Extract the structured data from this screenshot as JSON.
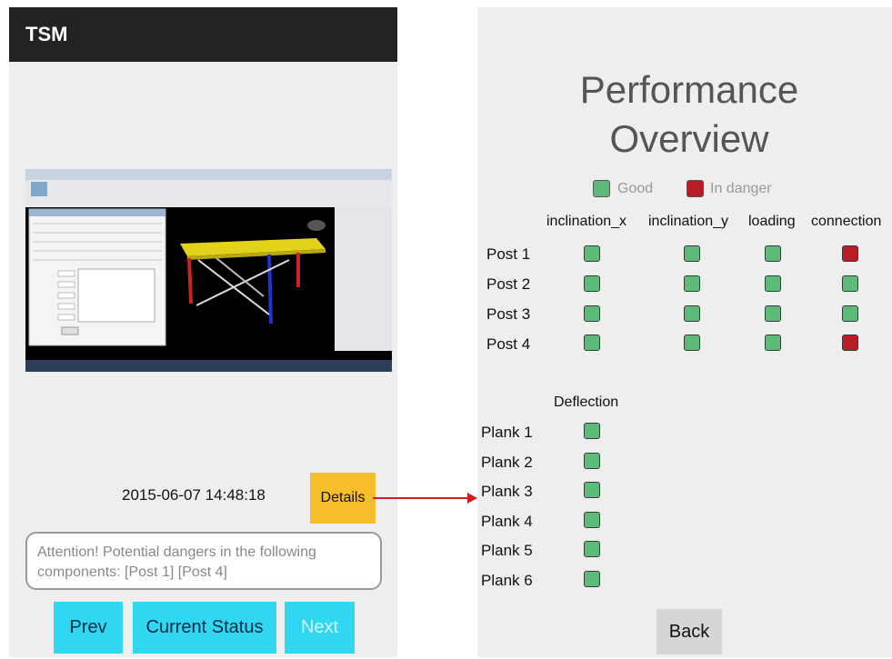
{
  "left_screen": {
    "app_title": "TSM",
    "timestamp": "2015-06-07 14:48:18",
    "details_label": "Details",
    "alert_text": "Attention! Potential dangers in the following components: [Post 1] [Post 4]",
    "buttons": {
      "prev": "Prev",
      "current": "Current Status",
      "next": "Next"
    }
  },
  "right_screen": {
    "title_line1": "Performance",
    "title_line2": "Overview",
    "legend": {
      "good": "Good",
      "danger": "In danger"
    },
    "colors": {
      "good": "#5dbb7a",
      "danger": "#b81c25"
    },
    "post_columns": [
      "inclination_x",
      "inclination_y",
      "loading",
      "connection"
    ],
    "posts": [
      {
        "label": "Post 1",
        "status": [
          "good",
          "good",
          "good",
          "danger"
        ]
      },
      {
        "label": "Post 2",
        "status": [
          "good",
          "good",
          "good",
          "good"
        ]
      },
      {
        "label": "Post 3",
        "status": [
          "good",
          "good",
          "good",
          "good"
        ]
      },
      {
        "label": "Post 4",
        "status": [
          "good",
          "good",
          "good",
          "danger"
        ]
      }
    ],
    "plank_column": "Deflection",
    "planks": [
      {
        "label": "Plank 1",
        "status": "good"
      },
      {
        "label": "Plank 2",
        "status": "good"
      },
      {
        "label": "Plank 3",
        "status": "good"
      },
      {
        "label": "Plank 4",
        "status": "good"
      },
      {
        "label": "Plank 5",
        "status": "good"
      },
      {
        "label": "Plank 6",
        "status": "good"
      }
    ],
    "back_label": "Back"
  }
}
